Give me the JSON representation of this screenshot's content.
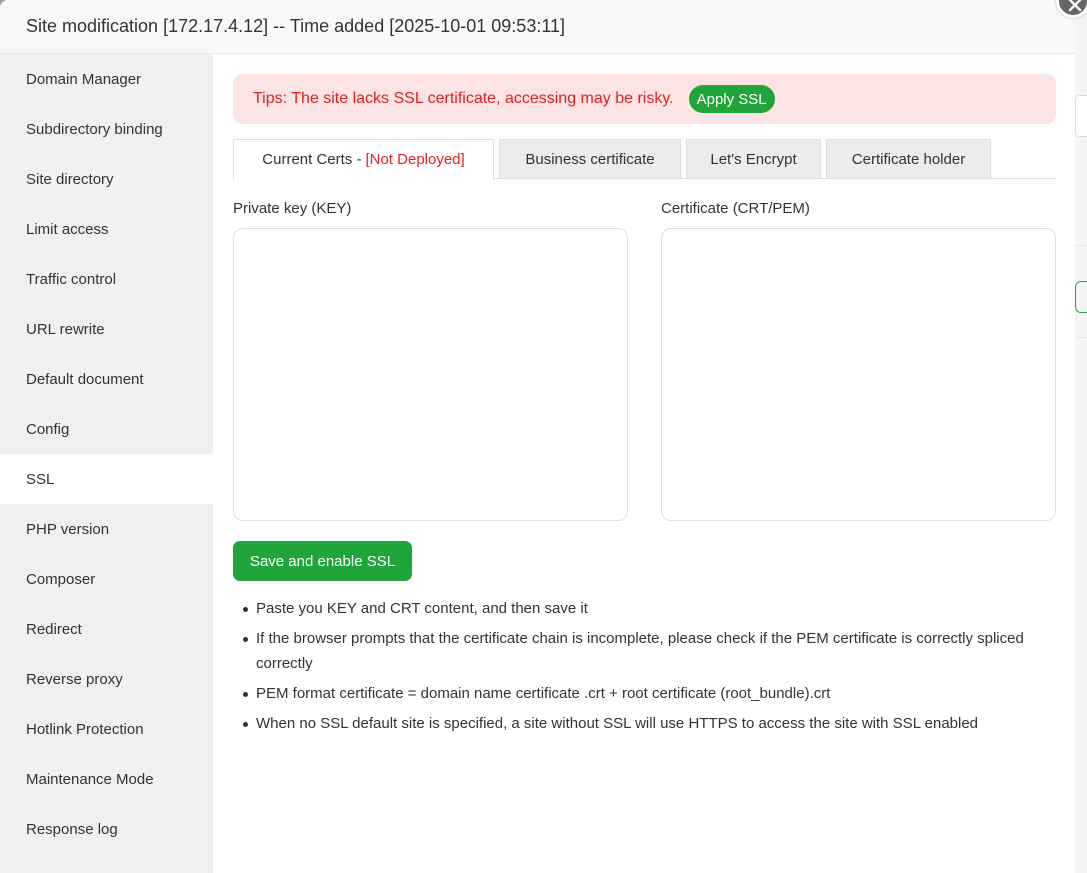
{
  "dialog": {
    "title": "Site modification [172.17.4.12] -- Time added [2025-10-01 09:53:11]"
  },
  "sidebar": {
    "items": [
      {
        "label": "Domain Manager"
      },
      {
        "label": "Subdirectory binding"
      },
      {
        "label": "Site directory"
      },
      {
        "label": "Limit access"
      },
      {
        "label": "Traffic control"
      },
      {
        "label": "URL rewrite"
      },
      {
        "label": "Default document"
      },
      {
        "label": "Config"
      },
      {
        "label": "SSL",
        "active": true
      },
      {
        "label": "PHP version"
      },
      {
        "label": "Composer"
      },
      {
        "label": "Redirect"
      },
      {
        "label": "Reverse proxy"
      },
      {
        "label": "Hotlink Protection"
      },
      {
        "label": "Maintenance Mode"
      },
      {
        "label": "Response log"
      }
    ]
  },
  "tips": {
    "text": "Tips: The site lacks SSL certificate, accessing may be risky.",
    "button": "Apply SSL"
  },
  "tabs": {
    "current": "Current Certs -",
    "status": "[Not Deployed]",
    "business": "Business certificate",
    "letsencrypt": "Let's Encrypt",
    "holder": "Certificate holder"
  },
  "form": {
    "key_label": "Private key (KEY)",
    "key_value": "",
    "cert_label": "Certificate (CRT/PEM)",
    "cert_value": "",
    "save_button": "Save and enable SSL"
  },
  "notes": [
    "Paste you KEY and CRT content, and then save it",
    "If the browser prompts that the certificate chain is incomplete, please check if the PEM certificate is correctly spliced correctly",
    "PEM format certificate = domain name certificate .crt + root certificate (root_bundle).crt",
    "When no SSL default site is specified, a site without SSL will use HTTPS to access the site with SSL enabled"
  ],
  "colors": {
    "accent_green": "#20a53a",
    "warning_red": "#e02020",
    "tips_bg": "#fce4e4",
    "sidebar_bg": "#f0f0f0"
  }
}
